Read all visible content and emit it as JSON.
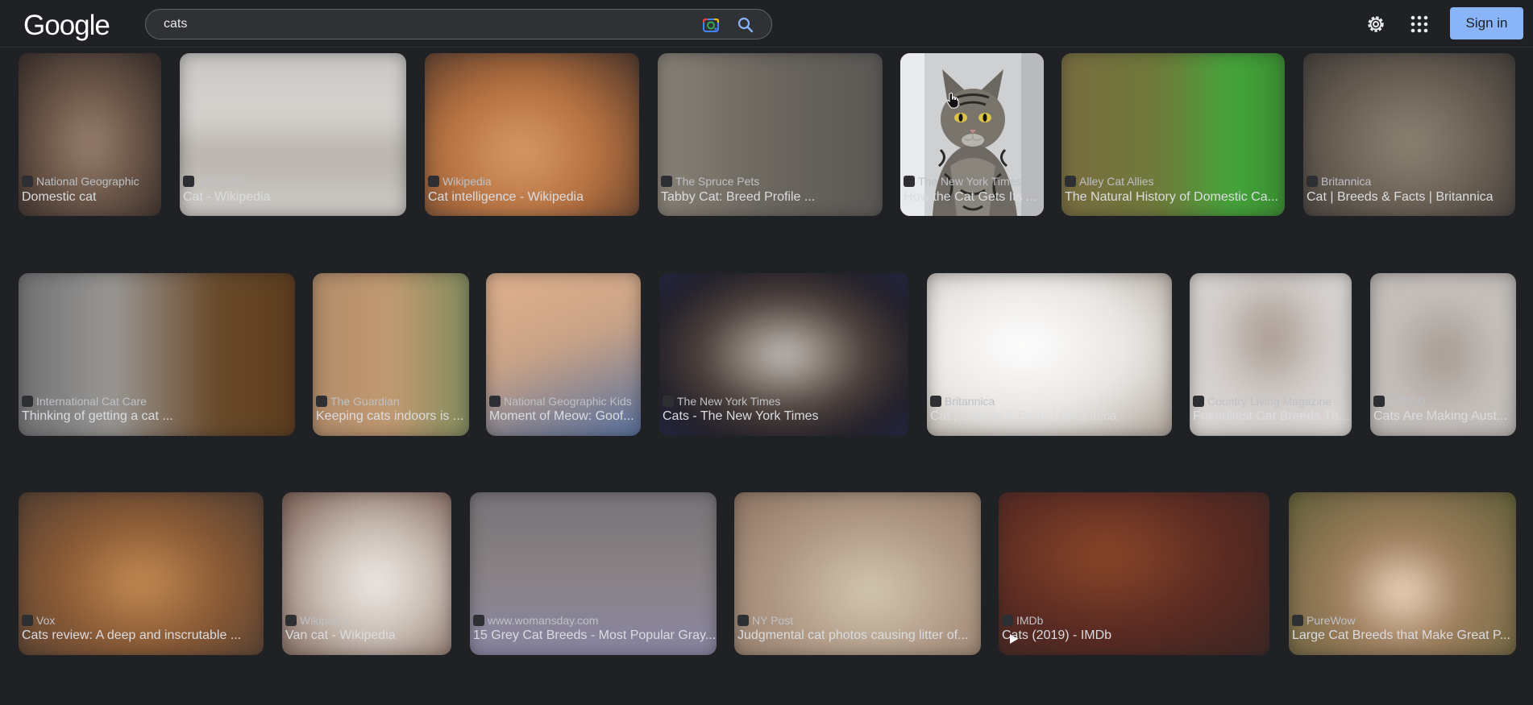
{
  "header": {
    "logo": "Google",
    "search_value": "cats",
    "sign_in": "Sign in"
  },
  "results": [
    {
      "source": "National Geographic",
      "title": "Domestic cat"
    },
    {
      "source": "Wikipedia",
      "title": "Cat - Wikipedia"
    },
    {
      "source": "Wikipedia",
      "title": "Cat intelligence - Wikipedia"
    },
    {
      "source": "The Spruce Pets",
      "title": "Tabby Cat: Breed Profile ..."
    },
    {
      "source": "The New York Times",
      "title": "How the Cat Gets Its ..."
    },
    {
      "source": "Alley Cat Allies",
      "title": "The Natural History of Domestic Ca..."
    },
    {
      "source": "Britannica",
      "title": "Cat | Breeds & Facts | Britannica"
    },
    {
      "source": "International Cat Care",
      "title": "Thinking of getting a cat ..."
    },
    {
      "source": "The Guardian",
      "title": "Keeping cats indoors is ..."
    },
    {
      "source": "National Geographic Kids",
      "title": "Moment of Meow: Goof..."
    },
    {
      "source": "The New York Times",
      "title": "Cats - The New York Times"
    },
    {
      "source": "Britannica",
      "title": "Cat | Breeds & Facts | Britannica"
    },
    {
      "source": "Country Living Magazine",
      "title": "Friendliest Cat Breeds Th..."
    },
    {
      "source": "WIRED",
      "title": "Cats Are Making Aust..."
    },
    {
      "source": "Vox",
      "title": "Cats review: A deep and inscrutable ..."
    },
    {
      "source": "Wikipedia",
      "title": "Van cat - Wikipedia"
    },
    {
      "source": "www.womansday.com",
      "title": "15 Grey Cat Breeds - Most Popular Gray..."
    },
    {
      "source": "NY Post",
      "title": "Judgmental cat photos causing litter of..."
    },
    {
      "source": "IMDb",
      "title": "Cats (2019) - IMDb"
    },
    {
      "source": "PureWow",
      "title": "Large Cat Breeds that Make Great P..."
    }
  ],
  "colors": {
    "background": "#202124",
    "accent": "#8ab4f8"
  }
}
